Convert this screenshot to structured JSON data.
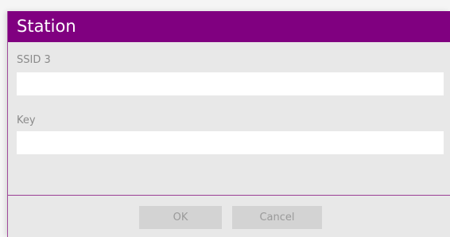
{
  "dialog": {
    "title": "Station",
    "ssid": {
      "label": "SSID 3",
      "value": "",
      "placeholder": ""
    },
    "key": {
      "label": "Key",
      "value": "",
      "placeholder": ""
    },
    "buttons": {
      "ok_label": "OK",
      "cancel_label": "Cancel"
    },
    "colors": {
      "title_bar": "#800080",
      "body": "#e8e8e8",
      "button_disabled": "#d3d3d3"
    }
  }
}
